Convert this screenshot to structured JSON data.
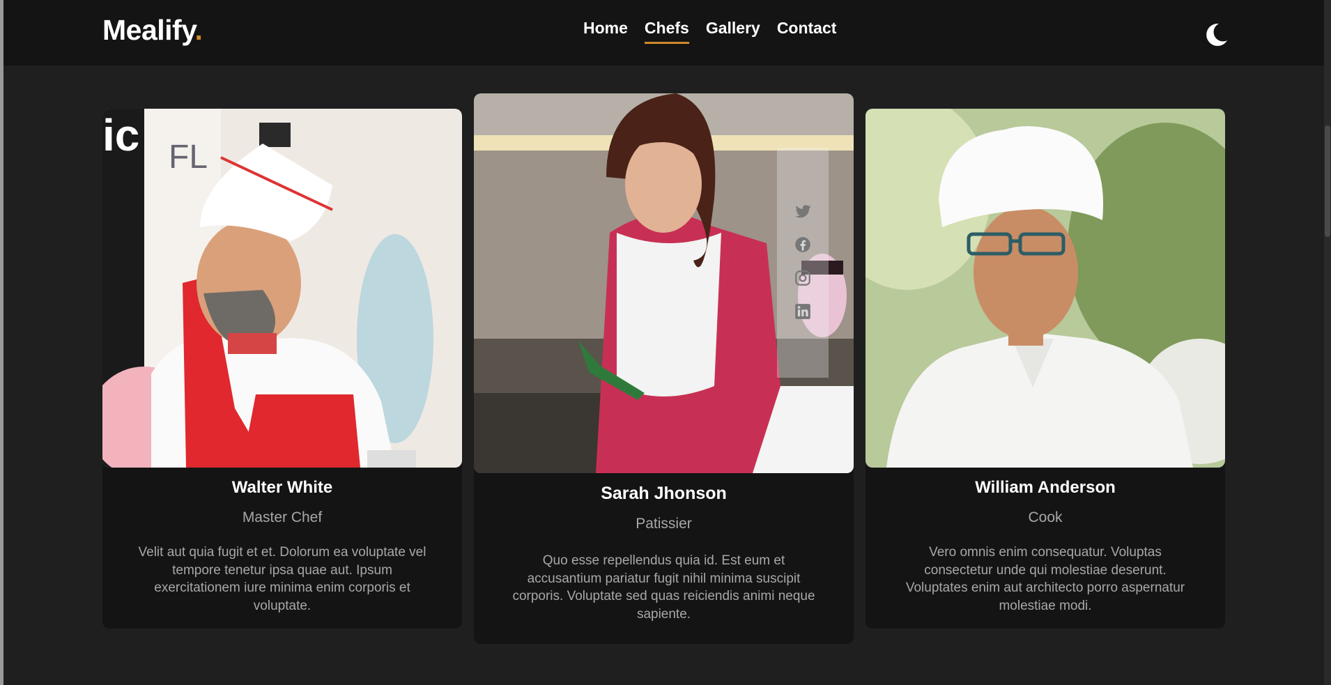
{
  "brand": {
    "name": "Mealify",
    "dot": "."
  },
  "nav": {
    "items": [
      {
        "label": "Home"
      },
      {
        "label": "Chefs",
        "active": true
      },
      {
        "label": "Gallery"
      },
      {
        "label": "Contact"
      }
    ]
  },
  "theme_toggle": {
    "icon": "moon-icon"
  },
  "colors": {
    "accent": "#ce8a2c",
    "background": "#1f1f1f",
    "header": "#141414",
    "card": "#141414",
    "muted_text": "#a8a8a8"
  },
  "chefs": [
    {
      "name": "Walter White",
      "role": "Master Chef",
      "bio": "Velit aut quia fugit et et. Dolorum ea voluptate vel tempore tenetur ipsa quae aut. Ipsum exercitationem iure minima enim corporis et voluptate."
    },
    {
      "name": "Sarah Jhonson",
      "role": "Patissier",
      "bio": "Quo esse repellendus quia id. Est eum et accusantium pariatur fugit nihil minima suscipit corporis. Voluptate sed quas reiciendis animi neque sapiente.",
      "social_icons": [
        "twitter-icon",
        "facebook-icon",
        "instagram-icon",
        "linkedin-icon"
      ]
    },
    {
      "name": "William Anderson",
      "role": "Cook",
      "bio": "Vero omnis enim consequatur. Voluptas consectetur unde qui molestiae deserunt. Voluptates enim aut architecto porro aspernatur molestiae modi."
    }
  ]
}
